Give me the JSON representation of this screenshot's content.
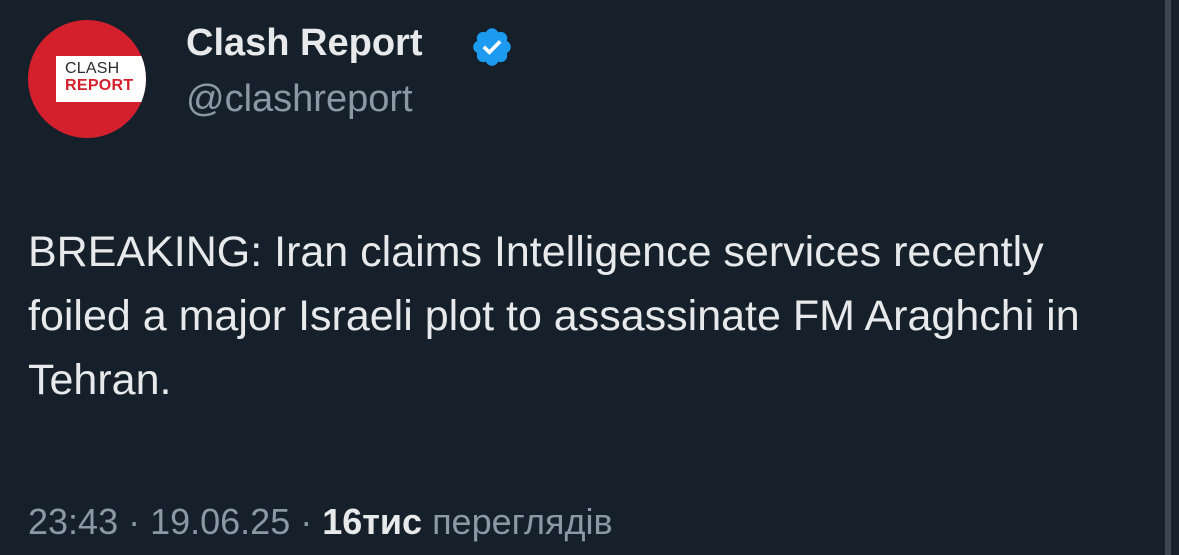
{
  "author": {
    "display_name": "Clash Report",
    "handle": "@clashreport",
    "avatar_logo_line1": "CLASH",
    "avatar_logo_line2": "REPORT",
    "verified_icon": "verified-badge-icon"
  },
  "tweet": {
    "text": "BREAKING: Iran claims Intelligence services recently foiled a major Israeli plot to assassinate FM Araghchi in Tehran."
  },
  "meta": {
    "time": "23:43",
    "separator": " · ",
    "date": "19.06.25",
    "views_count": "16тис",
    "views_label": " переглядів"
  },
  "colors": {
    "background": "#15202b",
    "primary_text": "#e7e9ea",
    "secondary_text": "#8b98a5",
    "verified_blue": "#1d9bf0",
    "avatar_red": "#d4202d"
  }
}
